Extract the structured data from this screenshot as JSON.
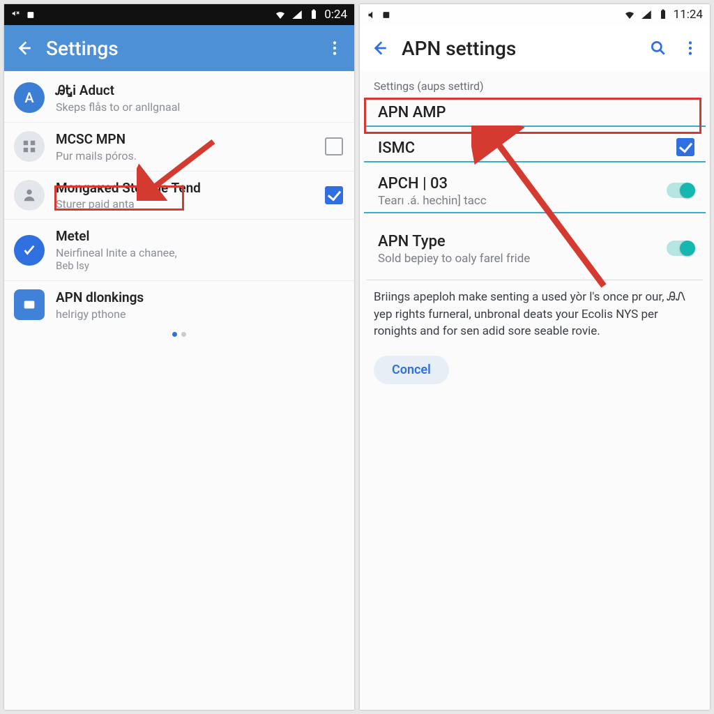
{
  "left": {
    "status": {
      "time": "0:24"
    },
    "appbar": {
      "title": "Settings"
    },
    "items": [
      {
        "avatar": "A",
        "title": "ᎯᎿi Aduct",
        "sub": "Skeps flås to or anllgnaal"
      },
      {
        "title": "MCSC MPN",
        "sub": "Pur mails póros."
      },
      {
        "title": "Mongaкed Storline Tend",
        "sub": "Sturer paid anta"
      },
      {
        "title": "Metel",
        "sub": "Neirfineal lnite a chanee,",
        "sub2": "Beb lsy"
      },
      {
        "title": "APN dlonkings",
        "sub": "helrigy pthone"
      }
    ]
  },
  "right": {
    "status": {
      "time": "11:24"
    },
    "appbar": {
      "title": "APN settings"
    },
    "subtitle": "Settings (aups settird)",
    "fields": [
      {
        "label": "APN AMP"
      },
      {
        "label": "ISMC"
      },
      {
        "label": "APCH | 03",
        "val": "Tearı .á. hechin] tacc"
      },
      {
        "label": "APN Type",
        "val": "Sold bepiey to oaly farel fride"
      }
    ],
    "desc": "Briings apeploh make senting a used yòr l's once pr our, ᎯᏁ yep rights furneral, unbronal deats your Ecolis NYS per ronights and for sen adid sore seable rovie.",
    "cancel": "Concel"
  }
}
